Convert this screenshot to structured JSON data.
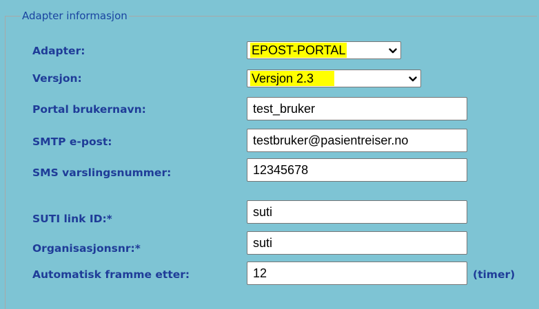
{
  "section": {
    "legend": "Adapter informasjon"
  },
  "fields": {
    "adapter": {
      "label": "Adapter:",
      "value": "EPOST-PORTAL"
    },
    "versjon": {
      "label": "Versjon:",
      "value": "Versjon 2.3"
    },
    "portal_brukernavn": {
      "label": "Portal brukernavn:",
      "value": "test_bruker"
    },
    "smtp_epost": {
      "label": "SMTP e-post:",
      "value": "testbruker@pasientreiser.no"
    },
    "sms_varslingsnummer": {
      "label": "SMS varslingsnummer:",
      "value": "12345678"
    },
    "suti_link_id": {
      "label": "SUTI link ID:*",
      "value": "suti"
    },
    "organisasjonsnr": {
      "label": "Organisasjonsnr:*",
      "value": "suti"
    },
    "automatisk_framme": {
      "label": "Automatisk framme etter:",
      "value": "12",
      "unit": "(timer)"
    }
  },
  "colors": {
    "panel_background": "#7ec4d4",
    "label_text": "#1f3c98",
    "selected_highlight": "#ffff00"
  },
  "icons": {
    "dropdown": "chevron-down-icon"
  }
}
